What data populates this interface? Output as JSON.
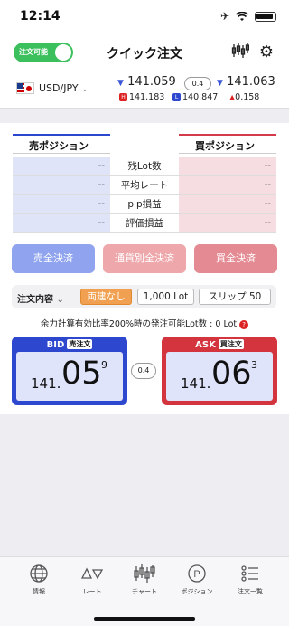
{
  "status_bar": {
    "time": "12:14"
  },
  "header": {
    "toggle_label": "注文可能",
    "title": "クイック注文"
  },
  "rate_bar": {
    "pair": "USD/JPY",
    "bid": "141.059",
    "spread": "0.4",
    "ask": "141.063",
    "high": "141.183",
    "high_badge": "H",
    "low": "140.847",
    "low_badge": "L",
    "change": "0.158"
  },
  "positions": {
    "sell_title": "売ポジション",
    "buy_title": "買ポジション",
    "rows": [
      {
        "label": "残Lot数",
        "sell": "--",
        "buy": "--"
      },
      {
        "label": "平均レート",
        "sell": "--",
        "buy": "--"
      },
      {
        "label": "pip損益",
        "sell": "--",
        "buy": "--"
      },
      {
        "label": "評価損益",
        "sell": "--",
        "buy": "--"
      }
    ]
  },
  "settle_buttons": {
    "sell_all": "売全決済",
    "by_pair": "通貨別全決済",
    "buy_all": "買全決済"
  },
  "order": {
    "label": "注文内容",
    "hedge": "両建なし",
    "lot": "1,000 Lot",
    "slip": "スリップ 50"
  },
  "margin_note": "余力計算有効比率200%時の発注可能Lot数 : 0 Lot",
  "quotes": {
    "bid_title": "BID",
    "bid_tag": "売注文",
    "bid_small": "141.",
    "bid_big": "05",
    "bid_sup": "9",
    "ask_title": "ASK",
    "ask_tag": "買注文",
    "ask_small": "141.",
    "ask_big": "06",
    "ask_sup": "3",
    "spread": "0.4"
  },
  "tabs": [
    {
      "label": "情報",
      "icon": "globe-icon"
    },
    {
      "label": "レート",
      "icon": "rate-triangles-icon"
    },
    {
      "label": "チャート",
      "icon": "candlestick-icon"
    },
    {
      "label": "ポジション",
      "icon": "position-p-icon"
    },
    {
      "label": "注文一覧",
      "icon": "order-list-icon"
    }
  ],
  "colors": {
    "sell": "#2d48cf",
    "buy": "#d3343d",
    "toggle": "#3cbf5d",
    "hedge_chip": "#f0a050"
  }
}
